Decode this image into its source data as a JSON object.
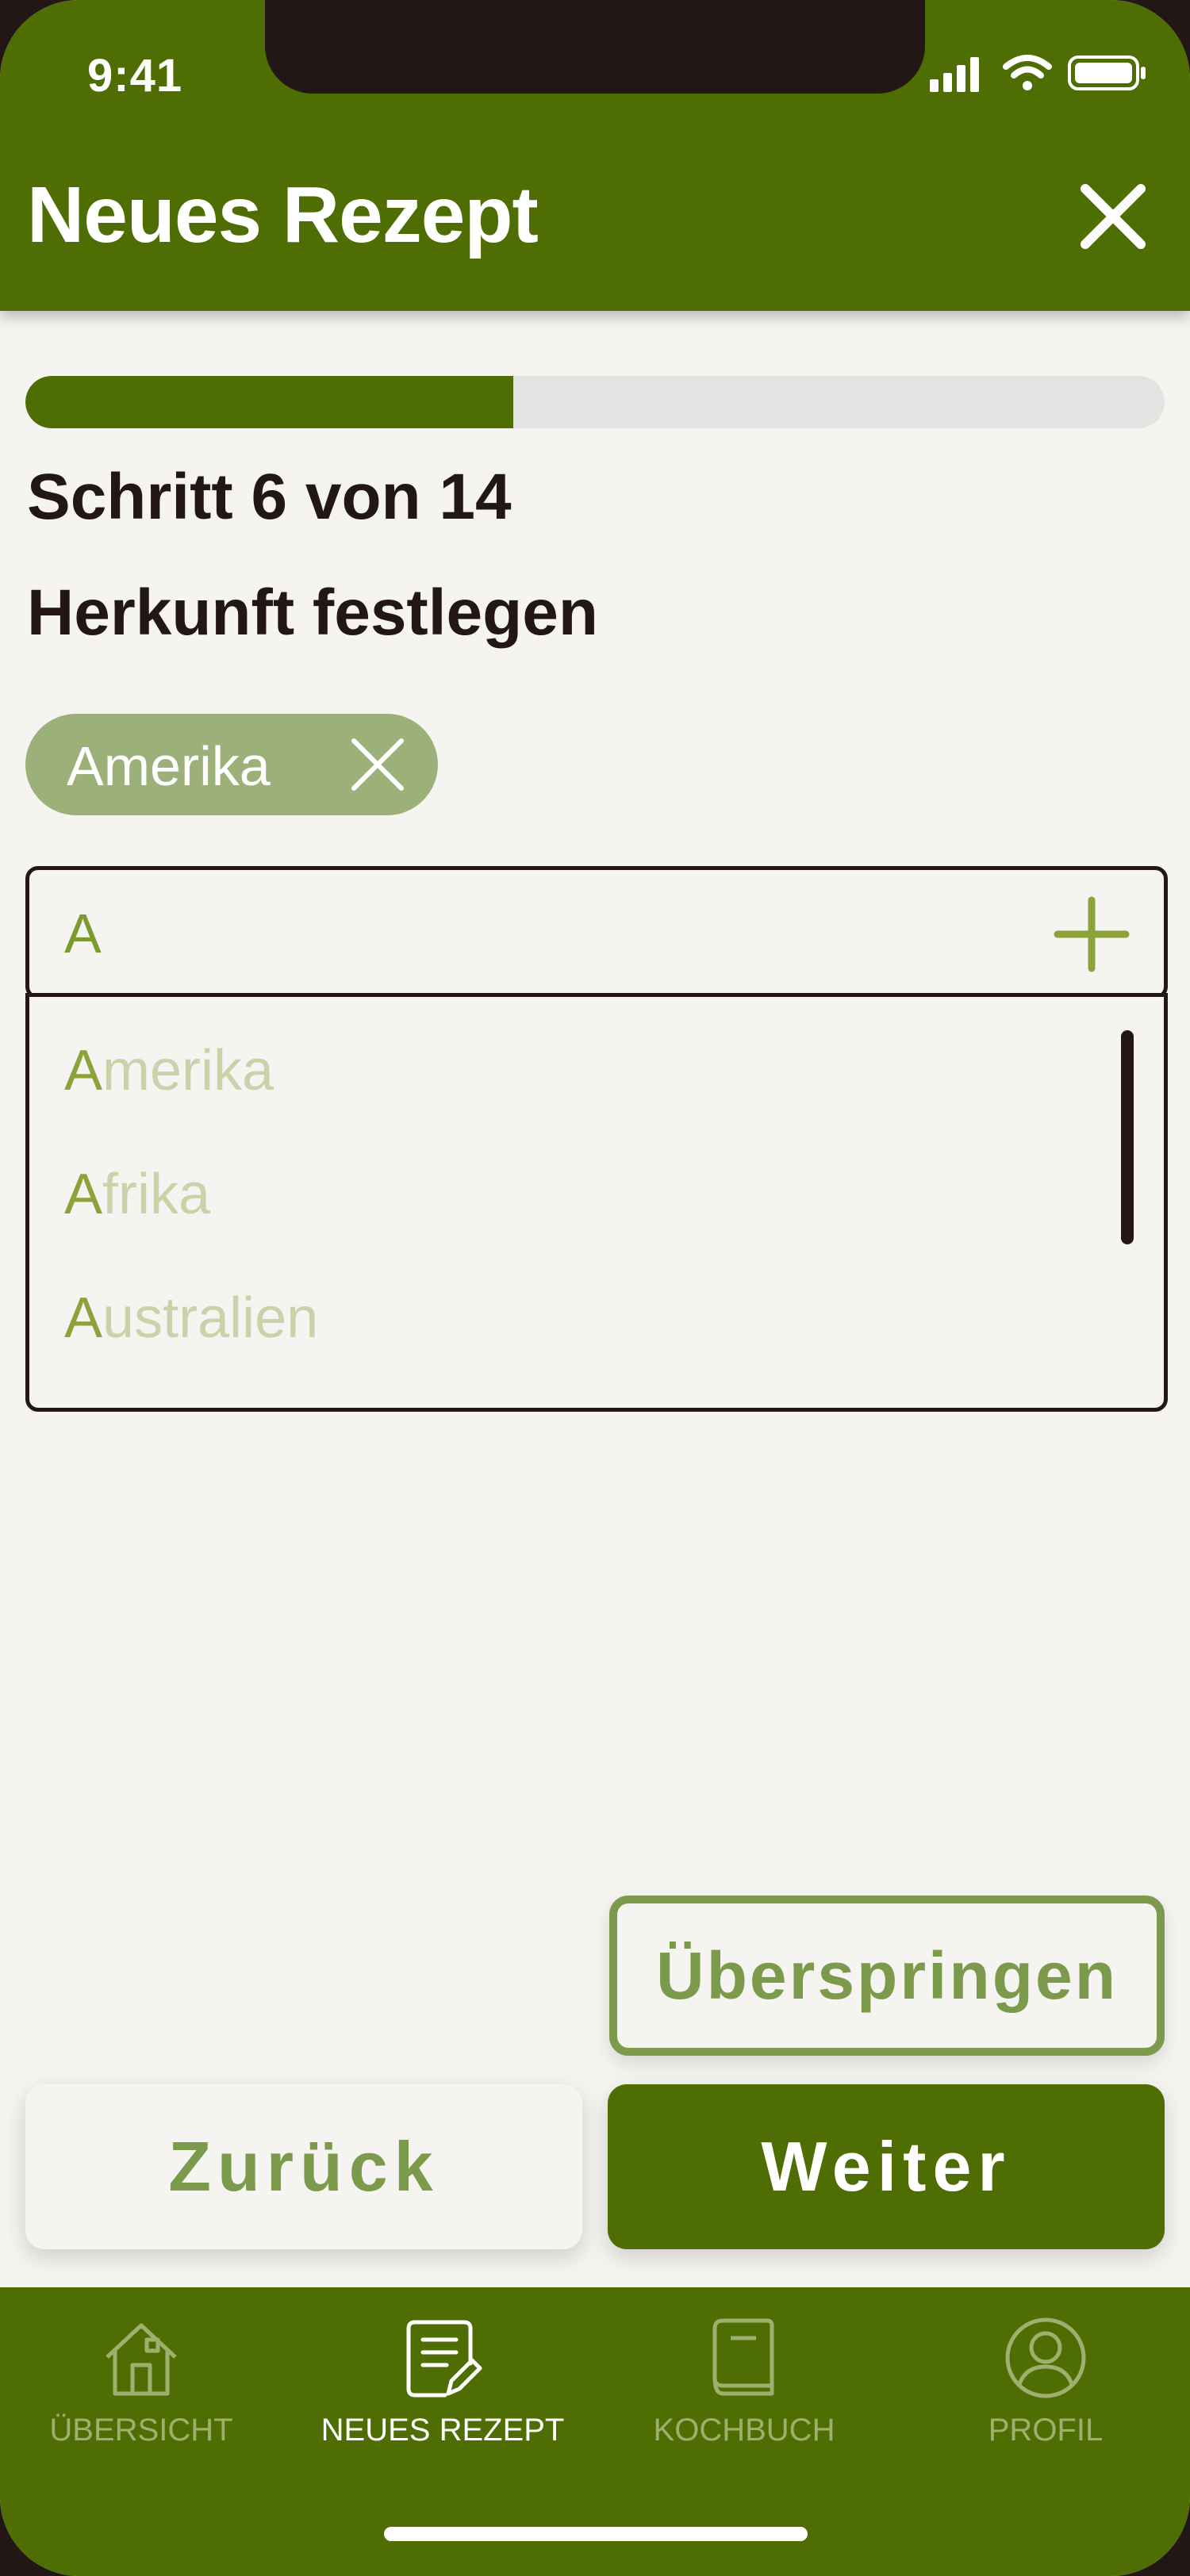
{
  "status_bar": {
    "time": "9:41",
    "icons": [
      "signal-icon",
      "wifi-icon",
      "battery-icon"
    ]
  },
  "header": {
    "title": "Neues Rezept",
    "close_icon": "close-icon"
  },
  "progress": {
    "step": 6,
    "total": 14,
    "fraction": 0.4286,
    "label": "Schritt 6 von 14"
  },
  "step_title": "Herkunft festlegen",
  "selected_tags": [
    {
      "label": "Amerika",
      "remove_icon": "close-icon"
    }
  ],
  "search": {
    "value": "A",
    "add_icon": "plus-icon"
  },
  "suggestions": [
    {
      "match": "A",
      "rest": "merika"
    },
    {
      "match": "A",
      "rest": "frika"
    },
    {
      "match": "A",
      "rest": "ustralien"
    }
  ],
  "actions": {
    "skip_label": "Überspringen",
    "back_label": "Zurück",
    "next_label": "Weiter"
  },
  "nav": {
    "items": [
      {
        "label": "ÜBERSICHT",
        "icon": "home-icon",
        "active": false
      },
      {
        "label": "NEUES REZEPT",
        "icon": "recipe-edit-icon",
        "active": true
      },
      {
        "label": "KOCHBUCH",
        "icon": "book-icon",
        "active": false
      },
      {
        "label": "PROFIL",
        "icon": "profile-icon",
        "active": false
      }
    ]
  },
  "colors": {
    "primary": "#4E6E04",
    "accent_light": "#9CB17A",
    "outline_green": "#7C9A4B",
    "text_dark": "#221715",
    "background": "#F5F4F1",
    "nav_inactive": "#9FB06E"
  }
}
